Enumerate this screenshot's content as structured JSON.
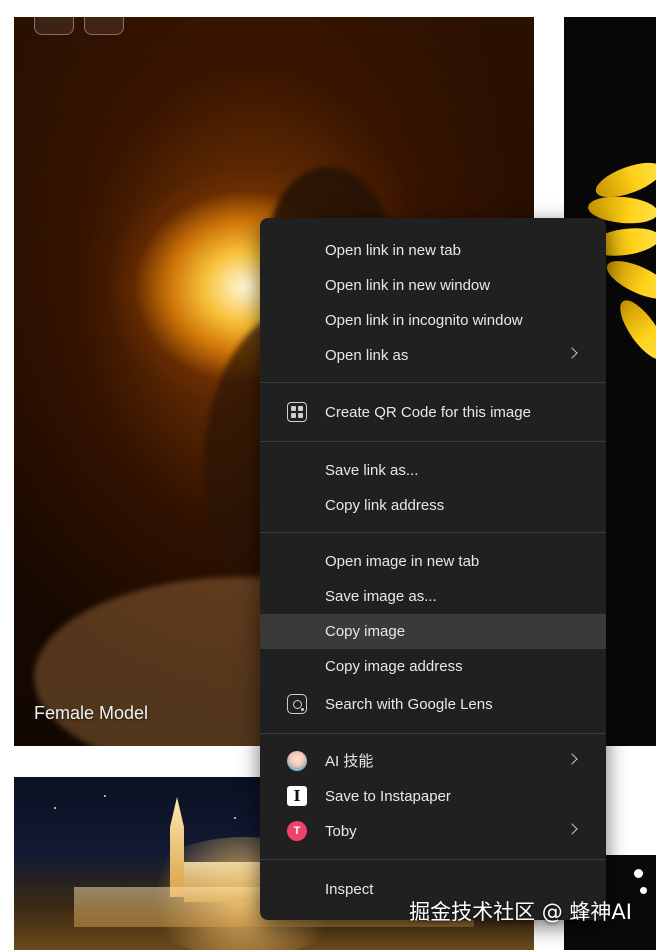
{
  "gallery": {
    "model_caption": "Female Model"
  },
  "context_menu": {
    "open_link_new_tab": "Open link in new tab",
    "open_link_new_window": "Open link in new window",
    "open_link_incognito": "Open link in incognito window",
    "open_link_as": "Open link as",
    "create_qr": "Create QR Code for this image",
    "save_link_as": "Save link as...",
    "copy_link_address": "Copy link address",
    "open_image_new_tab": "Open image in new tab",
    "save_image_as": "Save image as...",
    "copy_image": "Copy image",
    "copy_image_address": "Copy image address",
    "search_google_lens": "Search with Google Lens",
    "ai_skills": "AI 技能",
    "save_instapaper": "Save to Instapaper",
    "toby": "Toby",
    "inspect": "Inspect",
    "highlighted_item": "Copy image"
  },
  "icons": {
    "instapaper_glyph": "I",
    "toby_glyph": "T"
  },
  "watermark": "掘金技术社区 @ 蜂神AI",
  "colors": {
    "menu_bg": "#202020",
    "menu_hover": "#3a3a3a",
    "menu_text": "#e8e8e8",
    "separator": "#3d3d3d",
    "toby_brand": "#f0416c"
  }
}
